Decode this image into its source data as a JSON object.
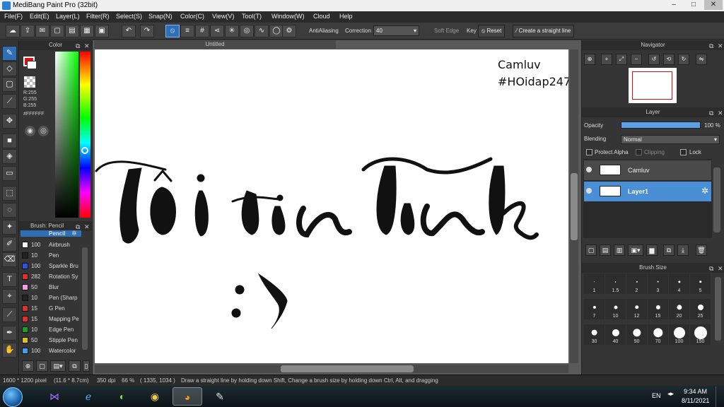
{
  "app": {
    "title": "MediBang Paint Pro (32bit)",
    "window_controls": [
      "–",
      "□",
      "✕"
    ]
  },
  "menu": [
    "File(F)",
    "Edit(E)",
    "Layer(L)",
    "Filter(R)",
    "Select(S)",
    "Snap(N)",
    "Color(C)",
    "View(V)",
    "Tool(T)",
    "Window(W)",
    "Cloud",
    "Help"
  ],
  "toolbar": {
    "antialiasing_label": "AntiAliasing",
    "antialiasing_checked": true,
    "correction_label": "Correction",
    "correction_value": "40",
    "soft_edge_label": "Soft Edge",
    "soft_edge_checked": false,
    "key_label": "Key",
    "reset_label": "Reset",
    "straight_line_label": "Create a straight line"
  },
  "color_panel": {
    "title": "Color",
    "fg_color": "#E01010",
    "r": "R:255",
    "g": "G:255",
    "b": "B:255",
    "hex": "#FFFFFF"
  },
  "brush_panel": {
    "title": "Brush: Pencil",
    "current": "Pencil",
    "items": [
      {
        "size": "100",
        "name": "Airbrush",
        "color": "#ffffff"
      },
      {
        "size": "10",
        "name": "Pen",
        "color": "#222222"
      },
      {
        "size": "100",
        "name": "Sparkle Bru",
        "color": "#3050e0"
      },
      {
        "size": "282",
        "name": "Rotation Sy",
        "color": "#e03030"
      },
      {
        "size": "50",
        "name": "Blur",
        "color": "#f0a0e0"
      },
      {
        "size": "10",
        "name": "Pen (Sharp",
        "color": "#222222"
      },
      {
        "size": "15",
        "name": "G Pen",
        "color": "#e03030"
      },
      {
        "size": "15",
        "name": "Mapping Pe",
        "color": "#e03030"
      },
      {
        "size": "10",
        "name": "Edge Pen",
        "color": "#20a020"
      },
      {
        "size": "50",
        "name": "Stipple Pen",
        "color": "#e0c020"
      },
      {
        "size": "100",
        "name": "Watercolor",
        "color": "#40a0f0"
      }
    ]
  },
  "document": {
    "tab_title": "Untitled",
    "text_line1": "Camluv",
    "text_line2": "#HOidap247",
    "script_text": "tôi tin Tınck",
    "smiley": ":>"
  },
  "navigator": {
    "title": "Navigator"
  },
  "layer_panel": {
    "title": "Layer",
    "opacity_label": "Opacity",
    "opacity_value": "100 %",
    "opacity_fraction": 1.0,
    "blending_label": "Blending",
    "blending_value": "Normal",
    "protect_alpha_label": "Protect Alpha",
    "clipping_label": "Clipping",
    "lock_label": "Lock",
    "layers": [
      {
        "name": "Camluv",
        "selected": false
      },
      {
        "name": "Layer1",
        "selected": true
      }
    ]
  },
  "brush_size_panel": {
    "title": "Brush Size",
    "sizes": [
      "1",
      "1.5",
      "2",
      "3",
      "4",
      "5",
      "7",
      "10",
      "12",
      "15",
      "20",
      "25",
      "30",
      "40",
      "50",
      "70",
      "100",
      "150"
    ]
  },
  "status": {
    "pixels": "1600 * 1200 pixel",
    "cm": "(11.6 * 8.7cm)",
    "dpi": "350 dpi",
    "zoom": "66 %",
    "coords": "( 1335, 1034 )",
    "hint": "Draw a straight line by holding down Shift, Change a brush size by holding down Ctrl, Alt, and dragging"
  },
  "taskbar": {
    "lang": "EN",
    "time": "9:34 AM",
    "date": "8/11/2021"
  }
}
